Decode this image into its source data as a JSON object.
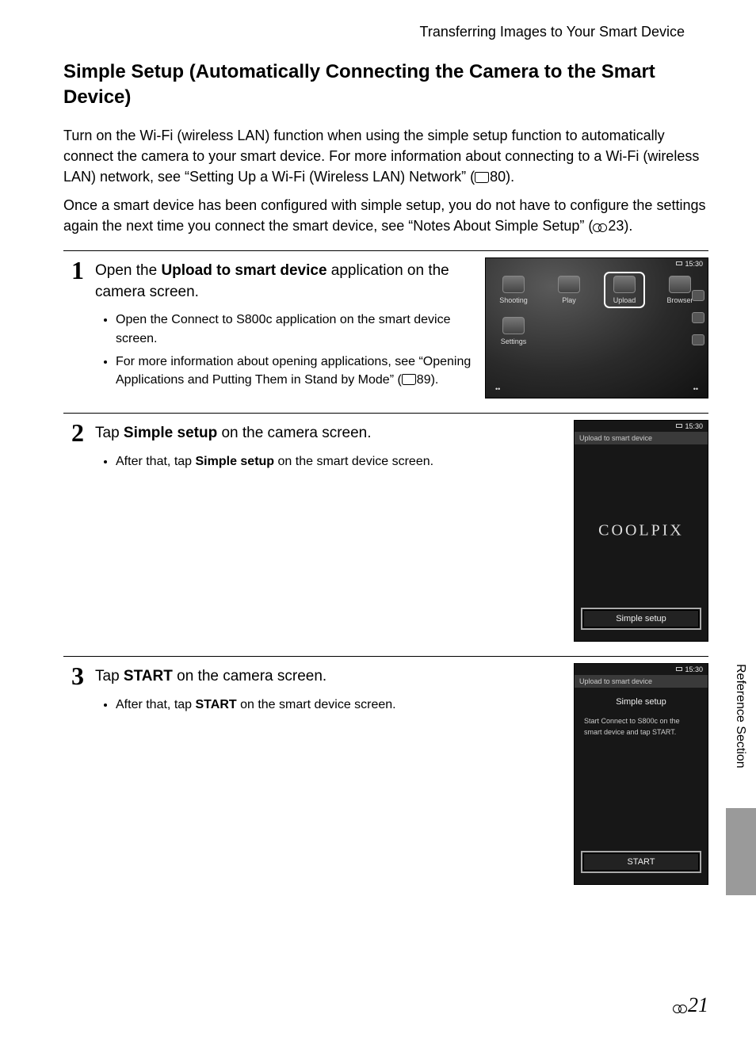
{
  "running_head": "Transferring Images to Your Smart Device",
  "heading": "Simple Setup (Automatically Connecting the Camera to the Smart Device)",
  "intro1_a": "Turn on the Wi-Fi (wireless LAN) function when using the simple setup function to automatically connect the camera to your smart device. For more information about connecting to a Wi-Fi (wireless LAN) network, see “Setting Up a Wi-Fi (Wireless LAN) Network” (",
  "intro1_ref": "80).",
  "intro2_a": "Once a smart device has been configured with simple setup, you do not have to configure the settings again the next time you connect the smart device, see “Notes About Simple Setup” (",
  "intro2_ref": "23).",
  "steps": {
    "1": {
      "num": "1",
      "title_a": "Open the ",
      "title_b": "Upload to smart device",
      "title_c": " application on the camera screen.",
      "bullet1": "Open the Connect to S800c application on the smart device screen.",
      "bullet2_a": "For more information about opening applications, see “Opening Applications and Putting Them in Stand by Mode” (",
      "bullet2_ref": "89).",
      "screen": {
        "time": "15:30",
        "apps": {
          "shooting": "Shooting",
          "play": "Play",
          "upload": "Upload",
          "browser": "Browser",
          "settings": "Settings"
        }
      }
    },
    "2": {
      "num": "2",
      "title_a": "Tap ",
      "title_b": "Simple setup",
      "title_c": " on the camera screen.",
      "bullet1_a": "After that, tap ",
      "bullet1_b": "Simple setup",
      "bullet1_c": " on the smart device screen.",
      "screen": {
        "time": "15:30",
        "titlebar": "Upload to smart device",
        "brand": "COOLPIX",
        "button": "Simple setup"
      }
    },
    "3": {
      "num": "3",
      "title_a": "Tap ",
      "title_b": "START",
      "title_c": " on the camera screen.",
      "bullet1_a": "After that, tap ",
      "bullet1_b": "START",
      "bullet1_c": " on the smart device screen.",
      "screen": {
        "time": "15:30",
        "titlebar": "Upload to smart device",
        "subhead": "Simple setup",
        "msg": "Start Connect to S800c on the smart device and tap START.",
        "button": "START"
      }
    }
  },
  "side_tab": "Reference Section",
  "page_number": "21"
}
